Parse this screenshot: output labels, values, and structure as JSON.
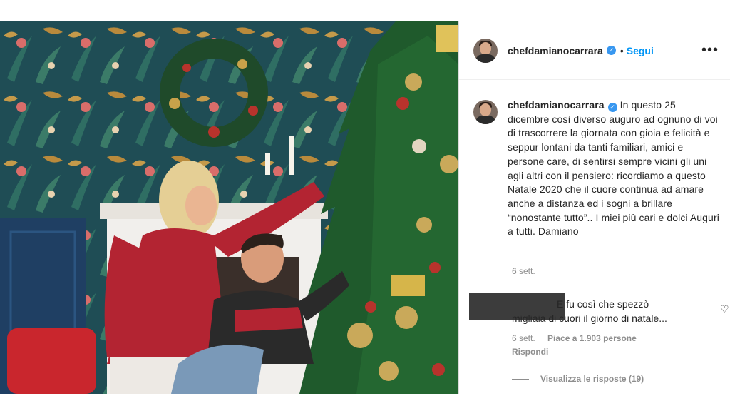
{
  "post": {
    "username": "chefdamianocarrara",
    "verified_icon": "verified-badge-icon",
    "separator": "•",
    "follow_label": "Segui",
    "more_label": "•••"
  },
  "caption": {
    "username": "chefdamianocarrara",
    "text": "In questo 25 dicembre così diverso auguro ad ognuno di voi di trascorrere la giornata con gioia e felicità e seppur lontani da tanti familiari, amici e persone care, di sentirsi sempre vicini gli uni agli altri con il pensiero: ricordiamo a questo Natale 2020 che il cuore continua ad amare anche a distanza ed i sogni a brillare “nonostante tutto”.. I miei più cari e dolci Auguri a tutti. Damiano",
    "timestamp": "6 sett."
  },
  "comment": {
    "text_line1": "E fu così che spezzò",
    "text_line2": "migliaia di cuori il giorno di natale...",
    "timestamp": "6 sett.",
    "likes": "Piace a 1.903 persone",
    "reply_label": "Rispondi",
    "view_replies": "Visualizza le risposte (19)"
  },
  "colors": {
    "link_blue": "#0095f6",
    "verified_blue": "#3897f0",
    "muted_gray": "#8e8e8e"
  }
}
